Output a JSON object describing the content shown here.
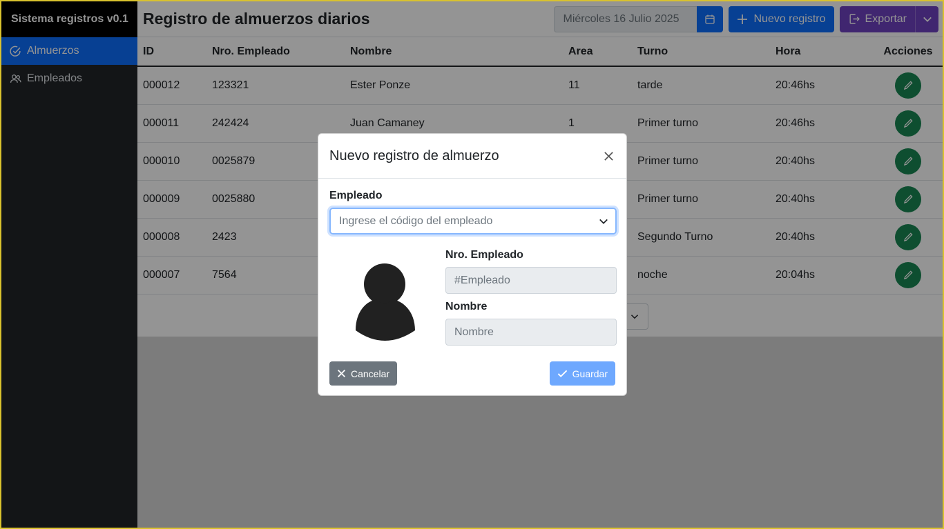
{
  "app": {
    "brand": "Sistema registros v0.1"
  },
  "sidebar": {
    "items": [
      {
        "label": "Almuerzos",
        "icon": "check-circle-icon",
        "active": true
      },
      {
        "label": "Empleados",
        "icon": "people-icon",
        "active": false
      }
    ]
  },
  "header": {
    "title": "Registro de almuerzos diarios",
    "date_value": "Miércoles 16 Julio 2025",
    "new_label": "Nuevo registro",
    "export_label": "Exportar"
  },
  "table": {
    "columns": [
      "ID",
      "Nro. Empleado",
      "Nombre",
      "Area",
      "Turno",
      "Hora",
      "Acciones"
    ],
    "rows": [
      [
        "000012",
        "123321",
        "Ester Ponze",
        "11",
        "tarde",
        "20:46hs"
      ],
      [
        "000011",
        "242424",
        "Juan Camaney",
        "1",
        "Primer turno",
        "20:46hs"
      ],
      [
        "000010",
        "0025879",
        "",
        "",
        "Primer turno",
        "20:40hs"
      ],
      [
        "000009",
        "0025880",
        "",
        "",
        "Primer turno",
        "20:40hs"
      ],
      [
        "000008",
        "2423",
        "",
        "",
        "Segundo Turno",
        "20:40hs"
      ],
      [
        "000007",
        "7564",
        "",
        "",
        "noche",
        "20:04hs"
      ]
    ]
  },
  "modal": {
    "title": "Nuevo registro de almuerzo",
    "empleado_label": "Empleado",
    "empleado_placeholder": "Ingrese el código del empleado",
    "nro_label": "Nro. Empleado",
    "nro_placeholder": "#Empleado",
    "nombre_label": "Nombre",
    "nombre_placeholder": "Nombre",
    "cancel_label": "Cancelar",
    "save_label": "Guardar"
  },
  "colors": {
    "primary": "#0d6efd",
    "export": "#6f42c1",
    "edit": "#198754",
    "sidebar": "#212529"
  }
}
